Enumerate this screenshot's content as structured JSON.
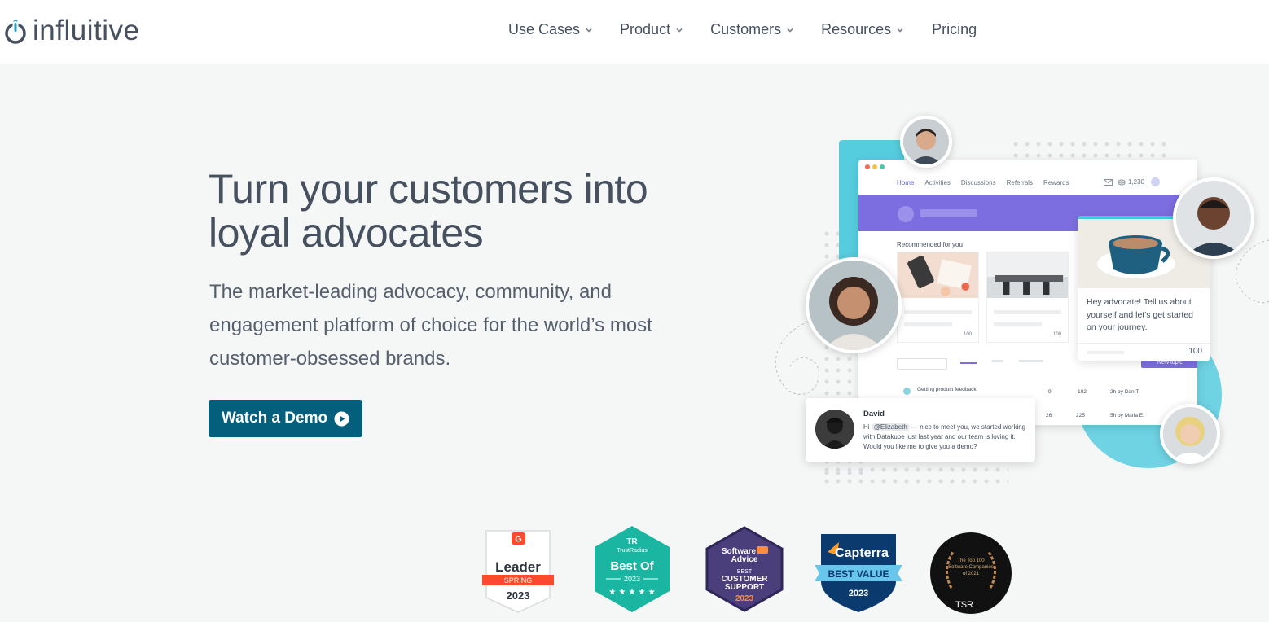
{
  "brand": {
    "name": "influitive",
    "primary_color": "#045f7c",
    "logo_accent": "#1ea0c3"
  },
  "nav": {
    "items": [
      {
        "label": "Use Cases",
        "has_dropdown": true
      },
      {
        "label": "Product",
        "has_dropdown": true
      },
      {
        "label": "Customers",
        "has_dropdown": true
      },
      {
        "label": "Resources",
        "has_dropdown": true
      }
    ],
    "pricing": "Pricing"
  },
  "hero": {
    "title": "Turn your customers into loyal advocates",
    "subtitle": "The market-leading advocacy, community, and engagement platform of choice for the world’s most customer-obsessed brands.",
    "cta_label": "Watch a Demo"
  },
  "mockup": {
    "tabs": [
      "Home",
      "Activities",
      "Discussions",
      "Referrals",
      "Rewards"
    ],
    "points_total": "1,230",
    "recommended_label": "Recommended for you",
    "card_points": "100",
    "new_topic_label": "New topic",
    "row1_title": "Getting product feedback",
    "row1_stats": [
      "9",
      "102"
    ],
    "row1_by": "2h by Dan T.",
    "row2_stats": [
      "26",
      "225"
    ],
    "row2_by": "5h by Maria E.",
    "bubble_message": "Hey advocate! Tell us about yourself and let's get started on your journey.",
    "bubble_points": "100",
    "chat_name": "David",
    "chat_greeting": "Hi",
    "chat_mention": "@Elizabeth",
    "chat_message": "— nice to meet you, we started working with Datakube just last year and our team is loving it. Would you like me to give you a demo?"
  },
  "badges": {
    "g2": {
      "title": "Leader",
      "season": "SPRING",
      "year": "2023"
    },
    "trustradius": {
      "brand": "TrustRadius",
      "title": "Best Of",
      "year": "2023"
    },
    "software_advice": {
      "brand1": "Software",
      "brand2": "Advice",
      "line1": "BEST",
      "line2": "CUSTOMER",
      "line3": "SUPPORT",
      "year": "2023"
    },
    "capterra": {
      "brand": "Capterra",
      "title": "BEST VALUE",
      "year": "2023"
    },
    "tsr": {
      "line1": "The Top 100",
      "line2": "Software Companies",
      "line3": "of 2021",
      "mark": "TSR"
    }
  }
}
